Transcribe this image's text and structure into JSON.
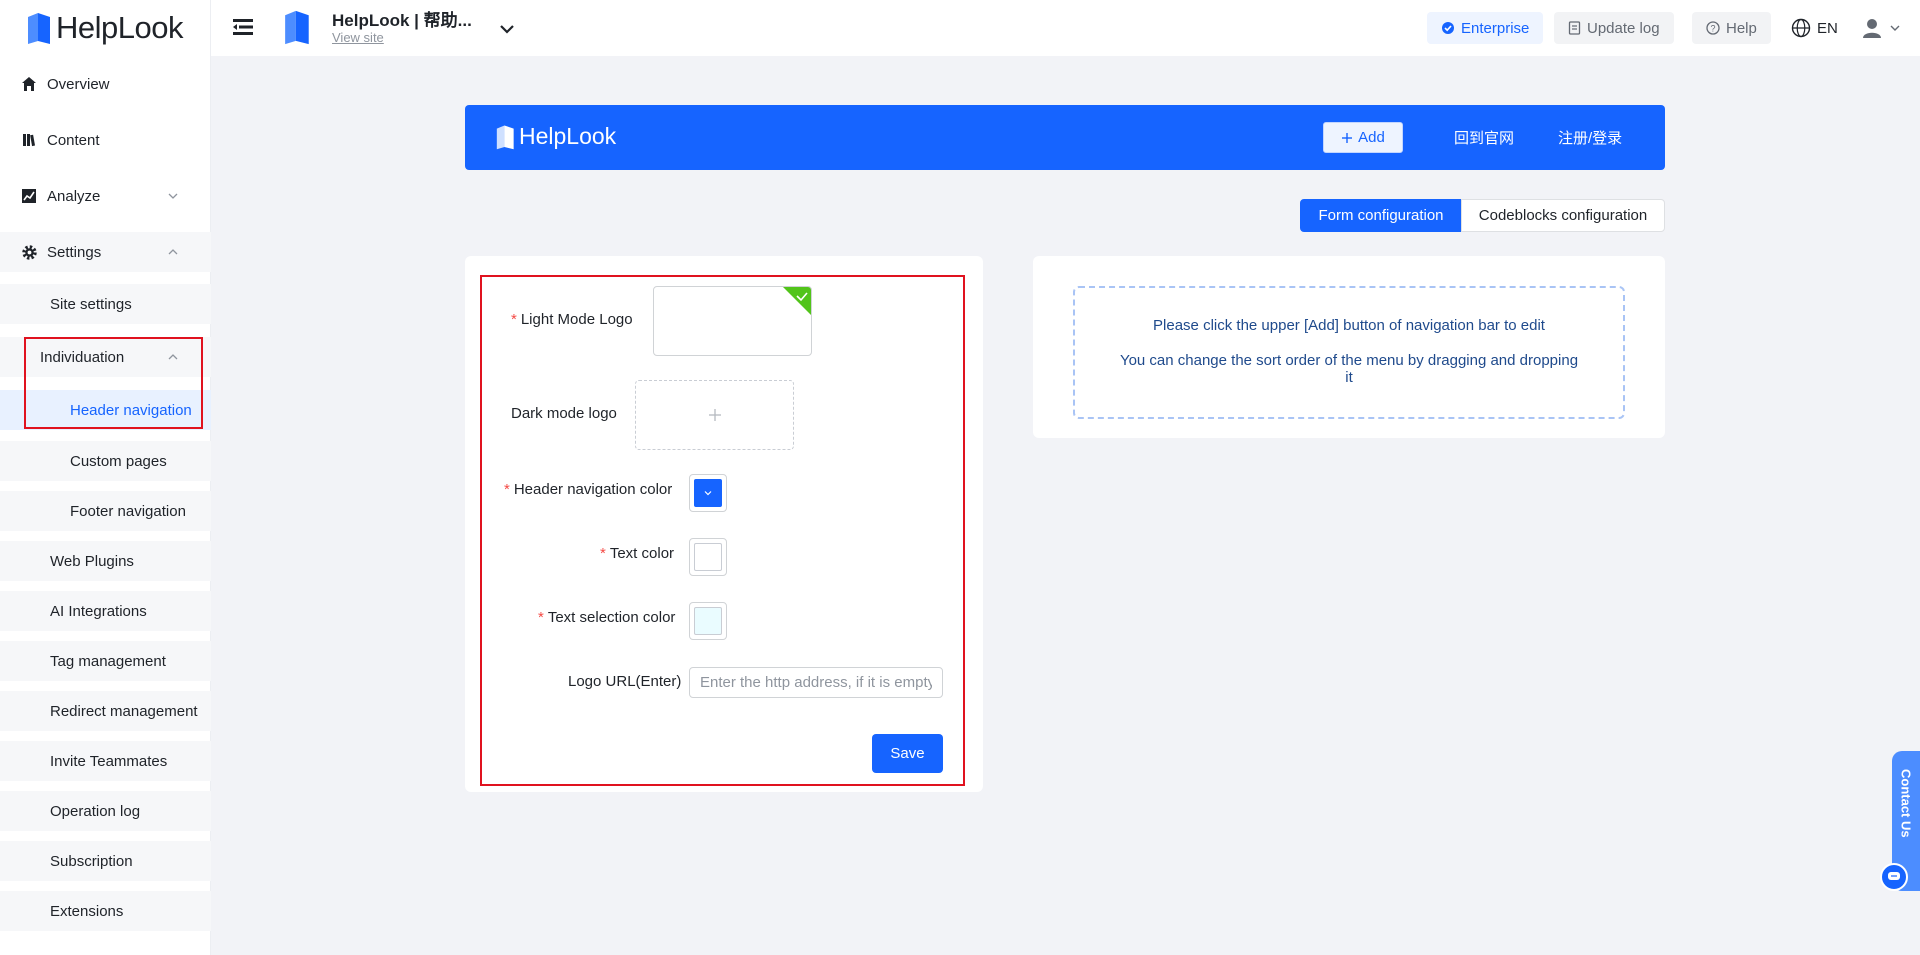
{
  "brand": {
    "name": "HelpLook"
  },
  "sidebar": {
    "items": [
      {
        "label": "Overview",
        "icon": "home-icon"
      },
      {
        "label": "Content",
        "icon": "book-icon"
      },
      {
        "label": "Analyze",
        "icon": "chart-icon"
      },
      {
        "label": "Settings",
        "icon": "gear-icon"
      }
    ],
    "settings_children": [
      "Site settings",
      "Individuation",
      "Web Plugins",
      "AI Integrations",
      "Tag management",
      "Redirect management",
      "Invite Teammates",
      "Operation log",
      "Subscription",
      "Extensions"
    ],
    "individuation_children": [
      "Header navigation",
      "Custom pages",
      "Footer navigation"
    ]
  },
  "topbar": {
    "site_name": "HelpLook | 帮助...",
    "view_site": "View site",
    "enterprise": "Enterprise",
    "update_log": "Update log",
    "help": "Help",
    "language": "EN"
  },
  "preview": {
    "logo_text": "HelpLook",
    "add_label": "Add",
    "links": [
      "回到官网",
      "注册/登录"
    ],
    "bg_color": "#1664ff"
  },
  "tabs": {
    "form": "Form configuration",
    "codeblocks": "Codeblocks configuration"
  },
  "form": {
    "light_logo_label": "Light Mode Logo",
    "dark_logo_label": "Dark mode logo",
    "header_color_label": "Header navigation color",
    "text_color_label": "Text color",
    "selection_color_label": "Text selection color",
    "logo_url_label": "Logo URL(Enter)",
    "logo_url_placeholder": "Enter the http address, if it is empty, it will jump to the home page",
    "logo_url_value": "",
    "save_label": "Save",
    "colors": {
      "header": "#1664ff",
      "text": "#ffffff",
      "selection": "#eafcff"
    }
  },
  "hint": {
    "line1": "Please click the upper [Add] button of navigation bar to edit",
    "line2": "You can change the sort order of the menu by dragging and dropping it"
  },
  "contact": {
    "label": "Contact Us"
  }
}
